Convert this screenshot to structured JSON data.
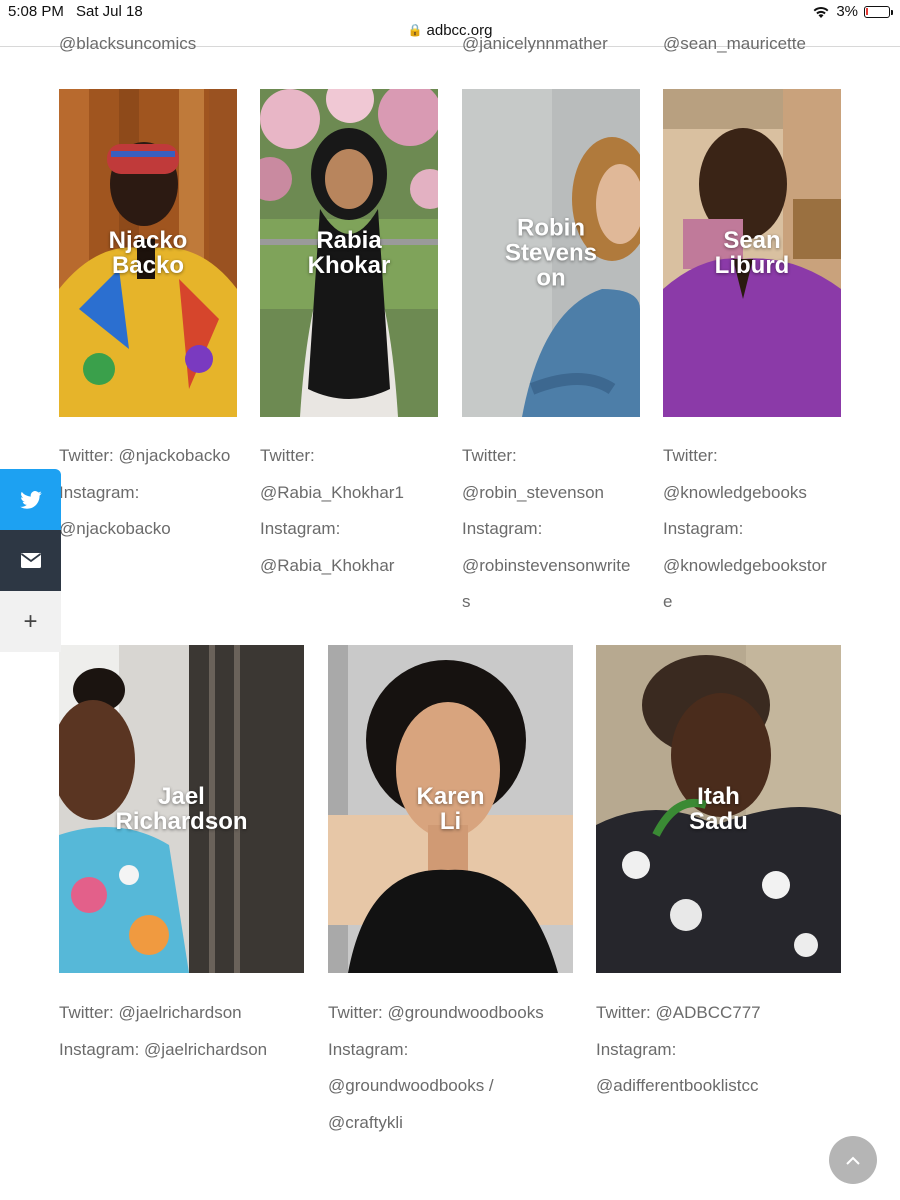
{
  "status": {
    "time": "5:08 PM",
    "date": "Sat Jul 18",
    "battery": "3%"
  },
  "browser": {
    "url": "adbcc.org"
  },
  "cut_handles": [
    "@blacksuncomics",
    "@janicelynnmather",
    "@sean_mauricette"
  ],
  "row1": [
    {
      "name": "Njacko Backo",
      "lines": [
        "Twitter: @njackobacko",
        "Instagram:",
        "@njackobacko"
      ]
    },
    {
      "name": "Rabia Khokar",
      "lines": [
        "Twitter:",
        "@Rabia_Khokhar1",
        "Instagram:",
        "@Rabia_Khokhar"
      ]
    },
    {
      "name": "Robin Stevens on",
      "lines": [
        "Twitter:",
        "@robin_stevenson",
        "Instagram:",
        "@robinstevensonwrite",
        "s"
      ]
    },
    {
      "name": "Sean Liburd",
      "lines": [
        "Twitter:",
        "@knowledgebooks",
        "Instagram:",
        "@knowledgebookstor",
        "e"
      ]
    }
  ],
  "row2": [
    {
      "name": "Jael Richardson",
      "lines": [
        "Twitter: @jaelrichardson",
        "Instagram: @jaelrichardson"
      ]
    },
    {
      "name": "Karen Li",
      "lines": [
        "Twitter: @groundwoodbooks",
        "Instagram:",
        "@groundwoodbooks /",
        "@craftykli"
      ]
    },
    {
      "name": "Itah Sadu",
      "lines": [
        "Twitter: @ADBCC777",
        "Instagram:",
        "@adifferentbooklistcc"
      ]
    }
  ],
  "share": {
    "more": "+"
  },
  "colors": {
    "twitter": "#1da1f2",
    "email": "#2d3744"
  },
  "icons": {
    "twitter": "twitter-icon",
    "email": "envelope-icon",
    "more": "plus-icon",
    "scroll": "chevron-up-icon"
  }
}
